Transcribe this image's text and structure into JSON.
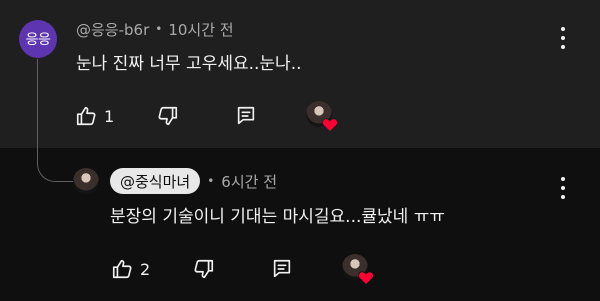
{
  "top_comment": {
    "avatar_text": "응응",
    "author": "@응응-b6r",
    "separator": "•",
    "time": "10시간 전",
    "text": "눈나 진짜 너무 고우세요..눈나..",
    "like_count": "1"
  },
  "reply_comment": {
    "author": "@중식마녀",
    "separator": "•",
    "time": "6시간 전",
    "text": "분장의 기술이니 기대는 마시길요...큘났네 ㅠㅠ",
    "like_count": "2"
  },
  "colors": {
    "background": "#0f0f0f",
    "top_comment_background": "#1f1f1f",
    "avatar_background": "#5e35b1",
    "heart": "#ff0033",
    "creator_chip": "#e8e8e8",
    "secondary_text": "#aaaaaa"
  },
  "icons": {
    "like": "thumb-up-icon",
    "dislike": "thumb-down-icon",
    "reply": "reply-comment-icon",
    "menu": "more-vert-icon",
    "creator_heart": "creator-heart-icon"
  }
}
